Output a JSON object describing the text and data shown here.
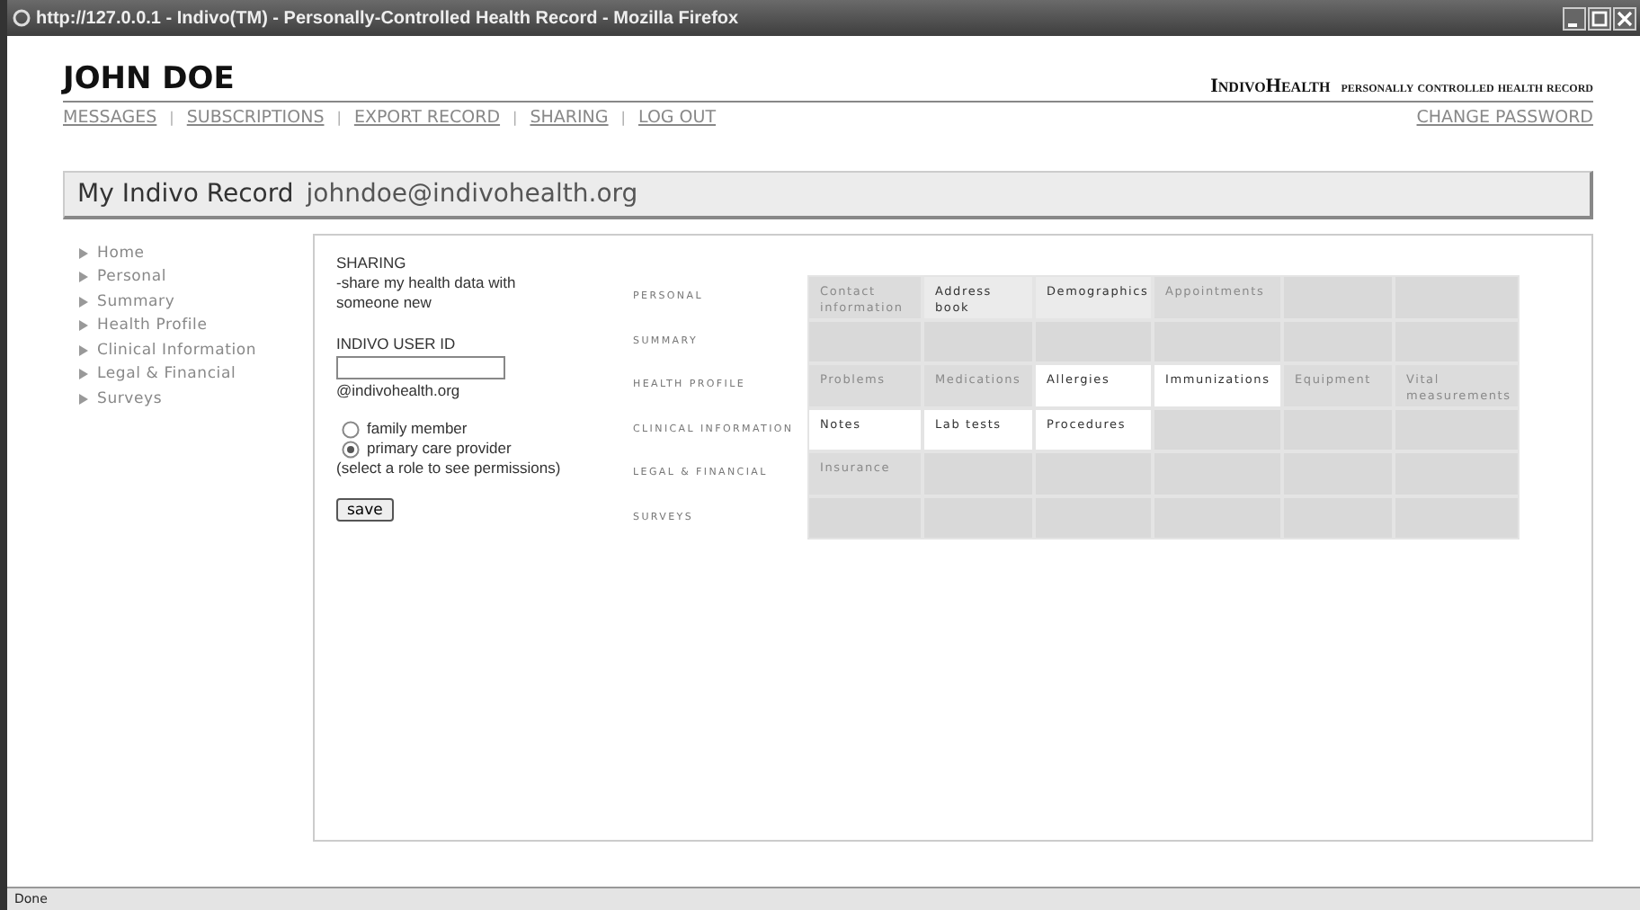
{
  "window": {
    "title": "http://127.0.0.1 - Indivo(TM) - Personally-Controlled Health Record - Mozilla Firefox"
  },
  "header": {
    "user_name": "JOHN DOE",
    "brand": "IndivoHealth",
    "tagline": "personally controlled health record"
  },
  "nav_links": [
    "MESSAGES",
    "SUBSCRIPTIONS",
    "EXPORT RECORD",
    "SHARING",
    "LOG OUT"
  ],
  "nav_separator": "|",
  "change_password": "CHANGE PASSWORD",
  "record_bar": {
    "title": "My Indivo Record",
    "email": "johndoe@indivohealth.org"
  },
  "sidebar": {
    "items": [
      "Home",
      "Personal",
      "Summary",
      "Health Profile",
      "Clinical Information",
      "Legal & Financial",
      "Surveys"
    ]
  },
  "sharing_form": {
    "heading": "SHARING",
    "description": "-share my health data with someone new",
    "user_id_label": "INDIVO USER ID",
    "domain": "@indivohealth.org",
    "roles": [
      {
        "label": "family member",
        "selected": false
      },
      {
        "label": "primary care provider",
        "selected": true
      }
    ],
    "hint": "(select a role to see permissions)",
    "save_button": "save"
  },
  "permissions": {
    "rows": [
      {
        "label": "PERSONAL",
        "cells": [
          {
            "kind": "item",
            "label": "Contact information",
            "enabled": false
          },
          {
            "kind": "item",
            "label": "Address book",
            "enabled": true,
            "granted": false
          },
          {
            "kind": "item",
            "label": "Demographics",
            "enabled": true,
            "granted": false
          },
          {
            "kind": "item",
            "label": "Appointments",
            "enabled": false
          },
          {
            "kind": "blank"
          },
          {
            "kind": "blank"
          }
        ]
      },
      {
        "label": "SUMMARY",
        "cells": [
          {
            "kind": "blank"
          },
          {
            "kind": "blank"
          },
          {
            "kind": "blank"
          },
          {
            "kind": "blank"
          },
          {
            "kind": "blank"
          },
          {
            "kind": "blank"
          }
        ]
      },
      {
        "label": "HEALTH PROFILE",
        "cells": [
          {
            "kind": "item",
            "label": "Problems",
            "enabled": false
          },
          {
            "kind": "item",
            "label": "Medications",
            "enabled": false
          },
          {
            "kind": "item",
            "label": "Allergies",
            "enabled": true,
            "granted": true
          },
          {
            "kind": "item",
            "label": "Immunizations",
            "enabled": true,
            "granted": true
          },
          {
            "kind": "item",
            "label": "Equipment",
            "enabled": false
          },
          {
            "kind": "item",
            "label": "Vital measurements",
            "enabled": false
          }
        ]
      },
      {
        "label": "CLINICAL INFORMATION",
        "cells": [
          {
            "kind": "item",
            "label": "Notes",
            "enabled": true,
            "granted": true
          },
          {
            "kind": "item",
            "label": "Lab tests",
            "enabled": true,
            "granted": true
          },
          {
            "kind": "item",
            "label": "Procedures",
            "enabled": true,
            "granted": true
          },
          {
            "kind": "blank"
          },
          {
            "kind": "blank"
          },
          {
            "kind": "blank"
          }
        ]
      },
      {
        "label": "LEGAL & FINANCIAL",
        "cells": [
          {
            "kind": "item",
            "label": "Insurance",
            "enabled": false
          },
          {
            "kind": "blank"
          },
          {
            "kind": "blank"
          },
          {
            "kind": "blank"
          },
          {
            "kind": "blank"
          },
          {
            "kind": "blank"
          }
        ]
      },
      {
        "label": "SURVEYS",
        "cells": [
          {
            "kind": "blank"
          },
          {
            "kind": "blank"
          },
          {
            "kind": "blank"
          },
          {
            "kind": "blank"
          },
          {
            "kind": "blank"
          },
          {
            "kind": "blank"
          }
        ]
      }
    ]
  },
  "status_bar": {
    "text": "Done"
  }
}
